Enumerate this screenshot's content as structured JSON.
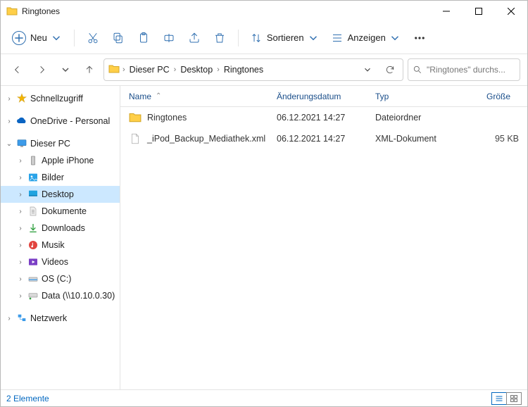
{
  "window": {
    "title": "Ringtones"
  },
  "toolbar": {
    "new_label": "Neu",
    "sort_label": "Sortieren",
    "view_label": "Anzeigen"
  },
  "breadcrumb": {
    "root": "Dieser PC",
    "mid": "Desktop",
    "leaf": "Ringtones"
  },
  "search": {
    "placeholder": "\"Ringtones\" durchs..."
  },
  "tree": {
    "quick": "Schnellzugriff",
    "onedrive": "OneDrive - Personal",
    "thispc": "Dieser PC",
    "net": "Netzwerk",
    "items": {
      "iphone": "Apple iPhone",
      "pictures": "Bilder",
      "desktop": "Desktop",
      "documents": "Dokumente",
      "downloads": "Downloads",
      "music": "Musik",
      "videos": "Videos",
      "osc": "OS (C:)",
      "data": "Data (\\\\10.10.0.30)"
    }
  },
  "columns": {
    "name": "Name",
    "date": "Änderungsdatum",
    "type": "Typ",
    "size": "Größe"
  },
  "rows": [
    {
      "name": "Ringtones",
      "date": "06.12.2021 14:27",
      "type": "Dateiordner",
      "size": ""
    },
    {
      "name": "_iPod_Backup_Mediathek.xml",
      "date": "06.12.2021 14:27",
      "type": "XML-Dokument",
      "size": "95 KB"
    }
  ],
  "status": {
    "text": "2 Elemente"
  }
}
